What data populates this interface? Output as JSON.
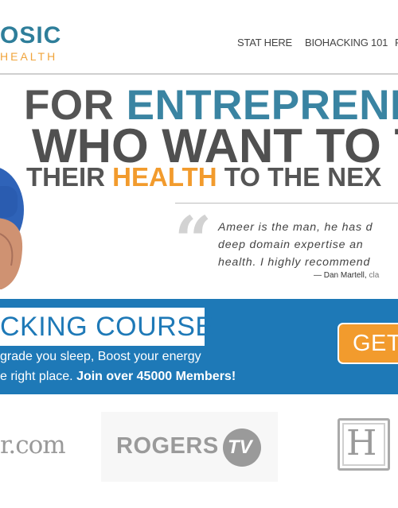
{
  "header": {
    "logo_top": "OSIC",
    "logo_bottom": "HEALTH",
    "nav": [
      "STAT HERE",
      "BIOHACKING 101",
      "F"
    ]
  },
  "hero": {
    "line1_a": "FOR ",
    "line1_b": "ENTREPRENE",
    "line2": "WHO WANT TO T",
    "line3_a": "THEIR ",
    "line3_b": "HEALTH",
    "line3_c": " TO THE NEX",
    "quote_mark": "“",
    "quote_lines": [
      "Ameer is the man, he has d",
      "deep domain expertise an",
      "health. I highly recommend"
    ],
    "quote_author": "— Dan Martell,",
    "quote_role": " cla"
  },
  "band": {
    "course_title": "CKING COURSE",
    "line1": "grade you sleep, Boost your energy",
    "line2_a": "e right place. ",
    "line2_b": "Join over 45000 Members!",
    "button_label": "GET"
  },
  "logos": {
    "com": "r.com",
    "rogers": "ROGERS",
    "tv": "TV",
    "h": "H"
  },
  "colors": {
    "brand_blue": "#1e79b7",
    "accent_orange": "#f29b2d",
    "logo_teal": "#2e7e9a"
  }
}
